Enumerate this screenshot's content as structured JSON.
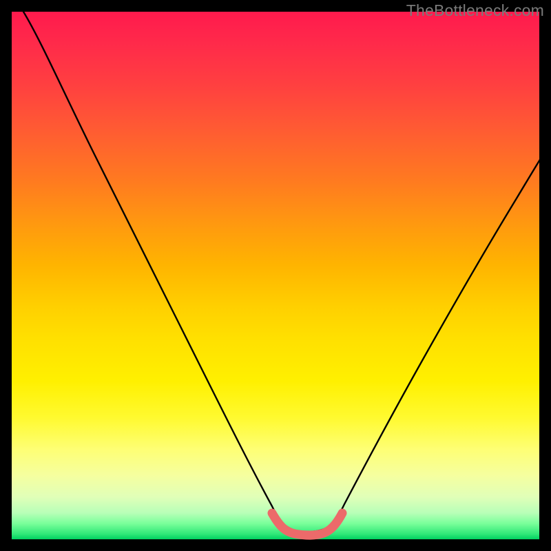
{
  "watermark": "TheBottleneck.com",
  "chart_data": {
    "type": "line",
    "title": "",
    "xlabel": "",
    "ylabel": "",
    "xlim": [
      0,
      100
    ],
    "ylim": [
      0,
      100
    ],
    "x": [
      2,
      8,
      15,
      22,
      30,
      38,
      44,
      48,
      50,
      52,
      56,
      58,
      60,
      65,
      72,
      80,
      88,
      95,
      100
    ],
    "values": [
      100,
      88,
      74,
      60,
      44,
      28,
      14,
      6,
      3,
      2,
      2,
      3,
      6,
      13,
      23,
      35,
      47,
      57,
      64
    ],
    "highlight_zone": {
      "x_start": 48,
      "x_end": 58
    },
    "gradient_stops": [
      {
        "pos": 0,
        "color": "#ff1a4d"
      },
      {
        "pos": 50,
        "color": "#ffd000"
      },
      {
        "pos": 85,
        "color": "#feff75"
      },
      {
        "pos": 100,
        "color": "#00d060"
      }
    ]
  }
}
